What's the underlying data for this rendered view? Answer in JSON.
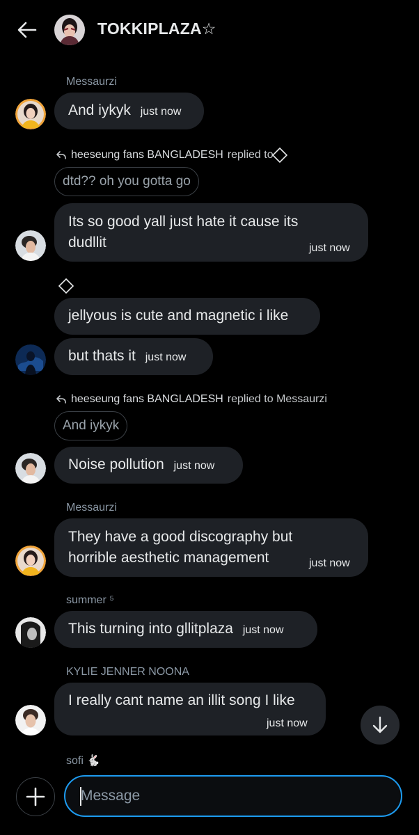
{
  "header": {
    "title": "TOKKIPLAZA☆",
    "back_icon": "arrow-left-icon"
  },
  "messages": [
    {
      "sender": "Messaurzi",
      "text": "And iykyk",
      "time": "just now"
    },
    {
      "reply": {
        "author": "heeseung fans BANGLADESH",
        "label": "replied to",
        "quote": "dtd?? oh you gotta go"
      },
      "text_lines": [
        "Its so good yall just hate it cause its",
        "dudllit"
      ],
      "time": "just now"
    },
    {
      "text": "jellyous is cute and magnetic i like"
    },
    {
      "text": "but thats it",
      "time": "just now"
    },
    {
      "reply": {
        "author": "heeseung fans BANGLADESH",
        "label": "replied to Messaurzi",
        "quote": "And iykyk"
      },
      "text": "Noise pollution",
      "time": "just now"
    },
    {
      "sender": "Messaurzi",
      "text_lines": [
        "They have a good discography but",
        "horrible aesthetic management"
      ],
      "time": "just now"
    },
    {
      "sender": "summer ⁵",
      "text": "This turning into gllitplaza",
      "time": "just now"
    },
    {
      "sender": "KYLIE JENNER NOONA",
      "text": "I really cant name an illit song I like",
      "time": "just now"
    },
    {
      "sender": "sofi 🐇"
    }
  ],
  "composer": {
    "placeholder": "Message",
    "plus_icon": "plus-icon",
    "scroll_icon": "arrow-down-icon"
  },
  "colors": {
    "accent": "#1d9bf0",
    "bubble": "#1e2126",
    "background": "#000000",
    "muted": "#8b98a5"
  }
}
